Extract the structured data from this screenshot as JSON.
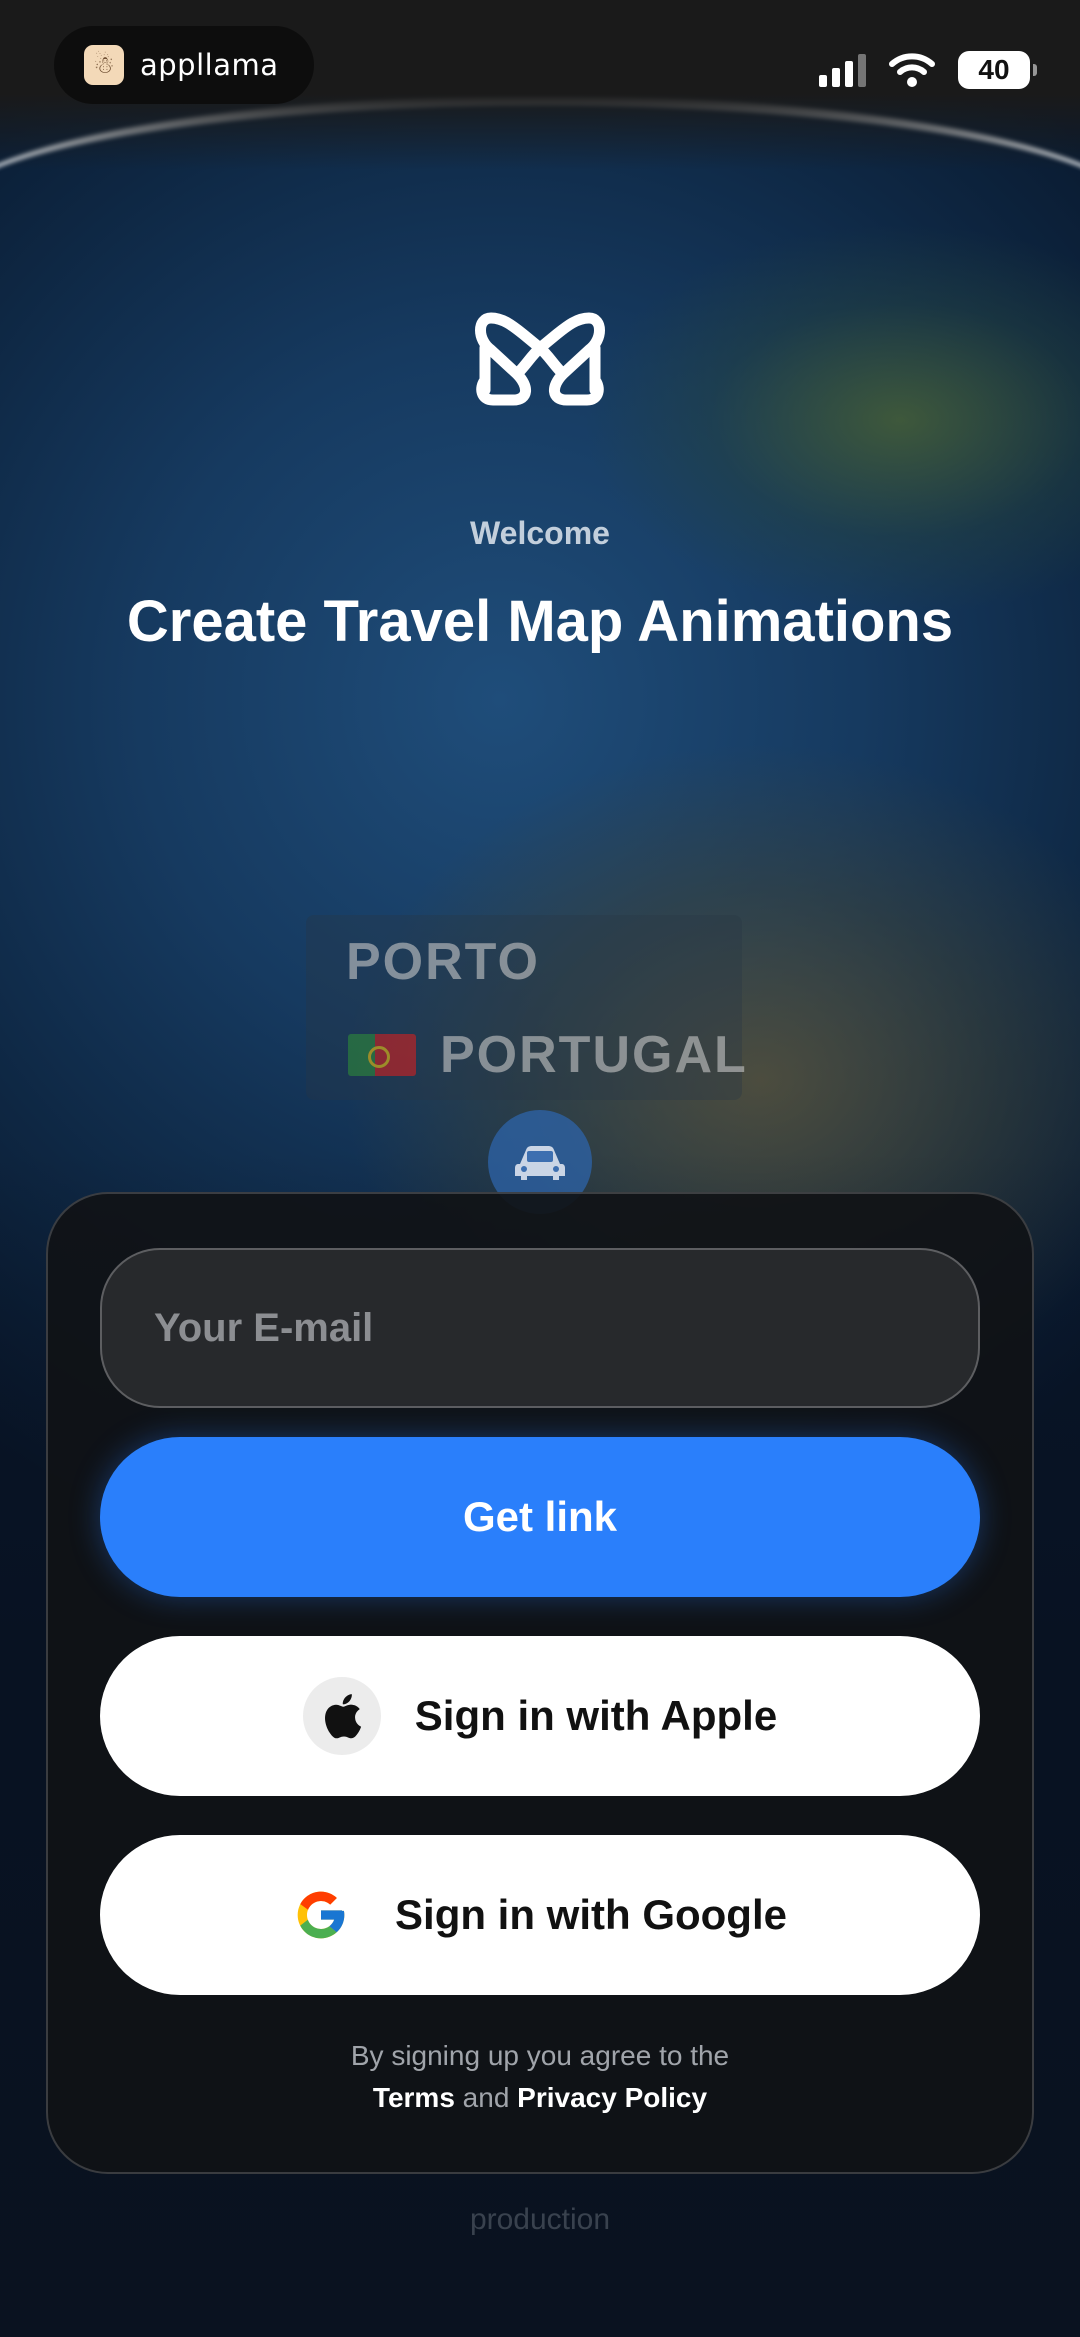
{
  "status_bar": {
    "brand_name": "appllama",
    "battery_level": "40",
    "icons": [
      "cellular-signal-icon",
      "wifi-icon",
      "battery-icon"
    ]
  },
  "hero": {
    "logo_icon": "app-logo-icon",
    "welcome": "Welcome",
    "headline": "Create Travel Map Animations"
  },
  "map_label": {
    "city": "PORTO",
    "country": "PORTUGAL",
    "flag_icon": "portugal-flag-icon",
    "marker_icon": "car-icon"
  },
  "signin": {
    "email_placeholder": "Your E-mail",
    "email_value": "",
    "get_link_label": "Get link",
    "apple_label": "Sign in with Apple",
    "google_label": "Sign in with Google",
    "legal_prefix": "By signing up you agree to the",
    "terms_label": "Terms",
    "and_text": "and",
    "privacy_label": "Privacy Policy"
  },
  "environment_label": "production",
  "colors": {
    "accent": "#2a7ffb",
    "card_background": "#101216",
    "field_background": "#27292c"
  }
}
